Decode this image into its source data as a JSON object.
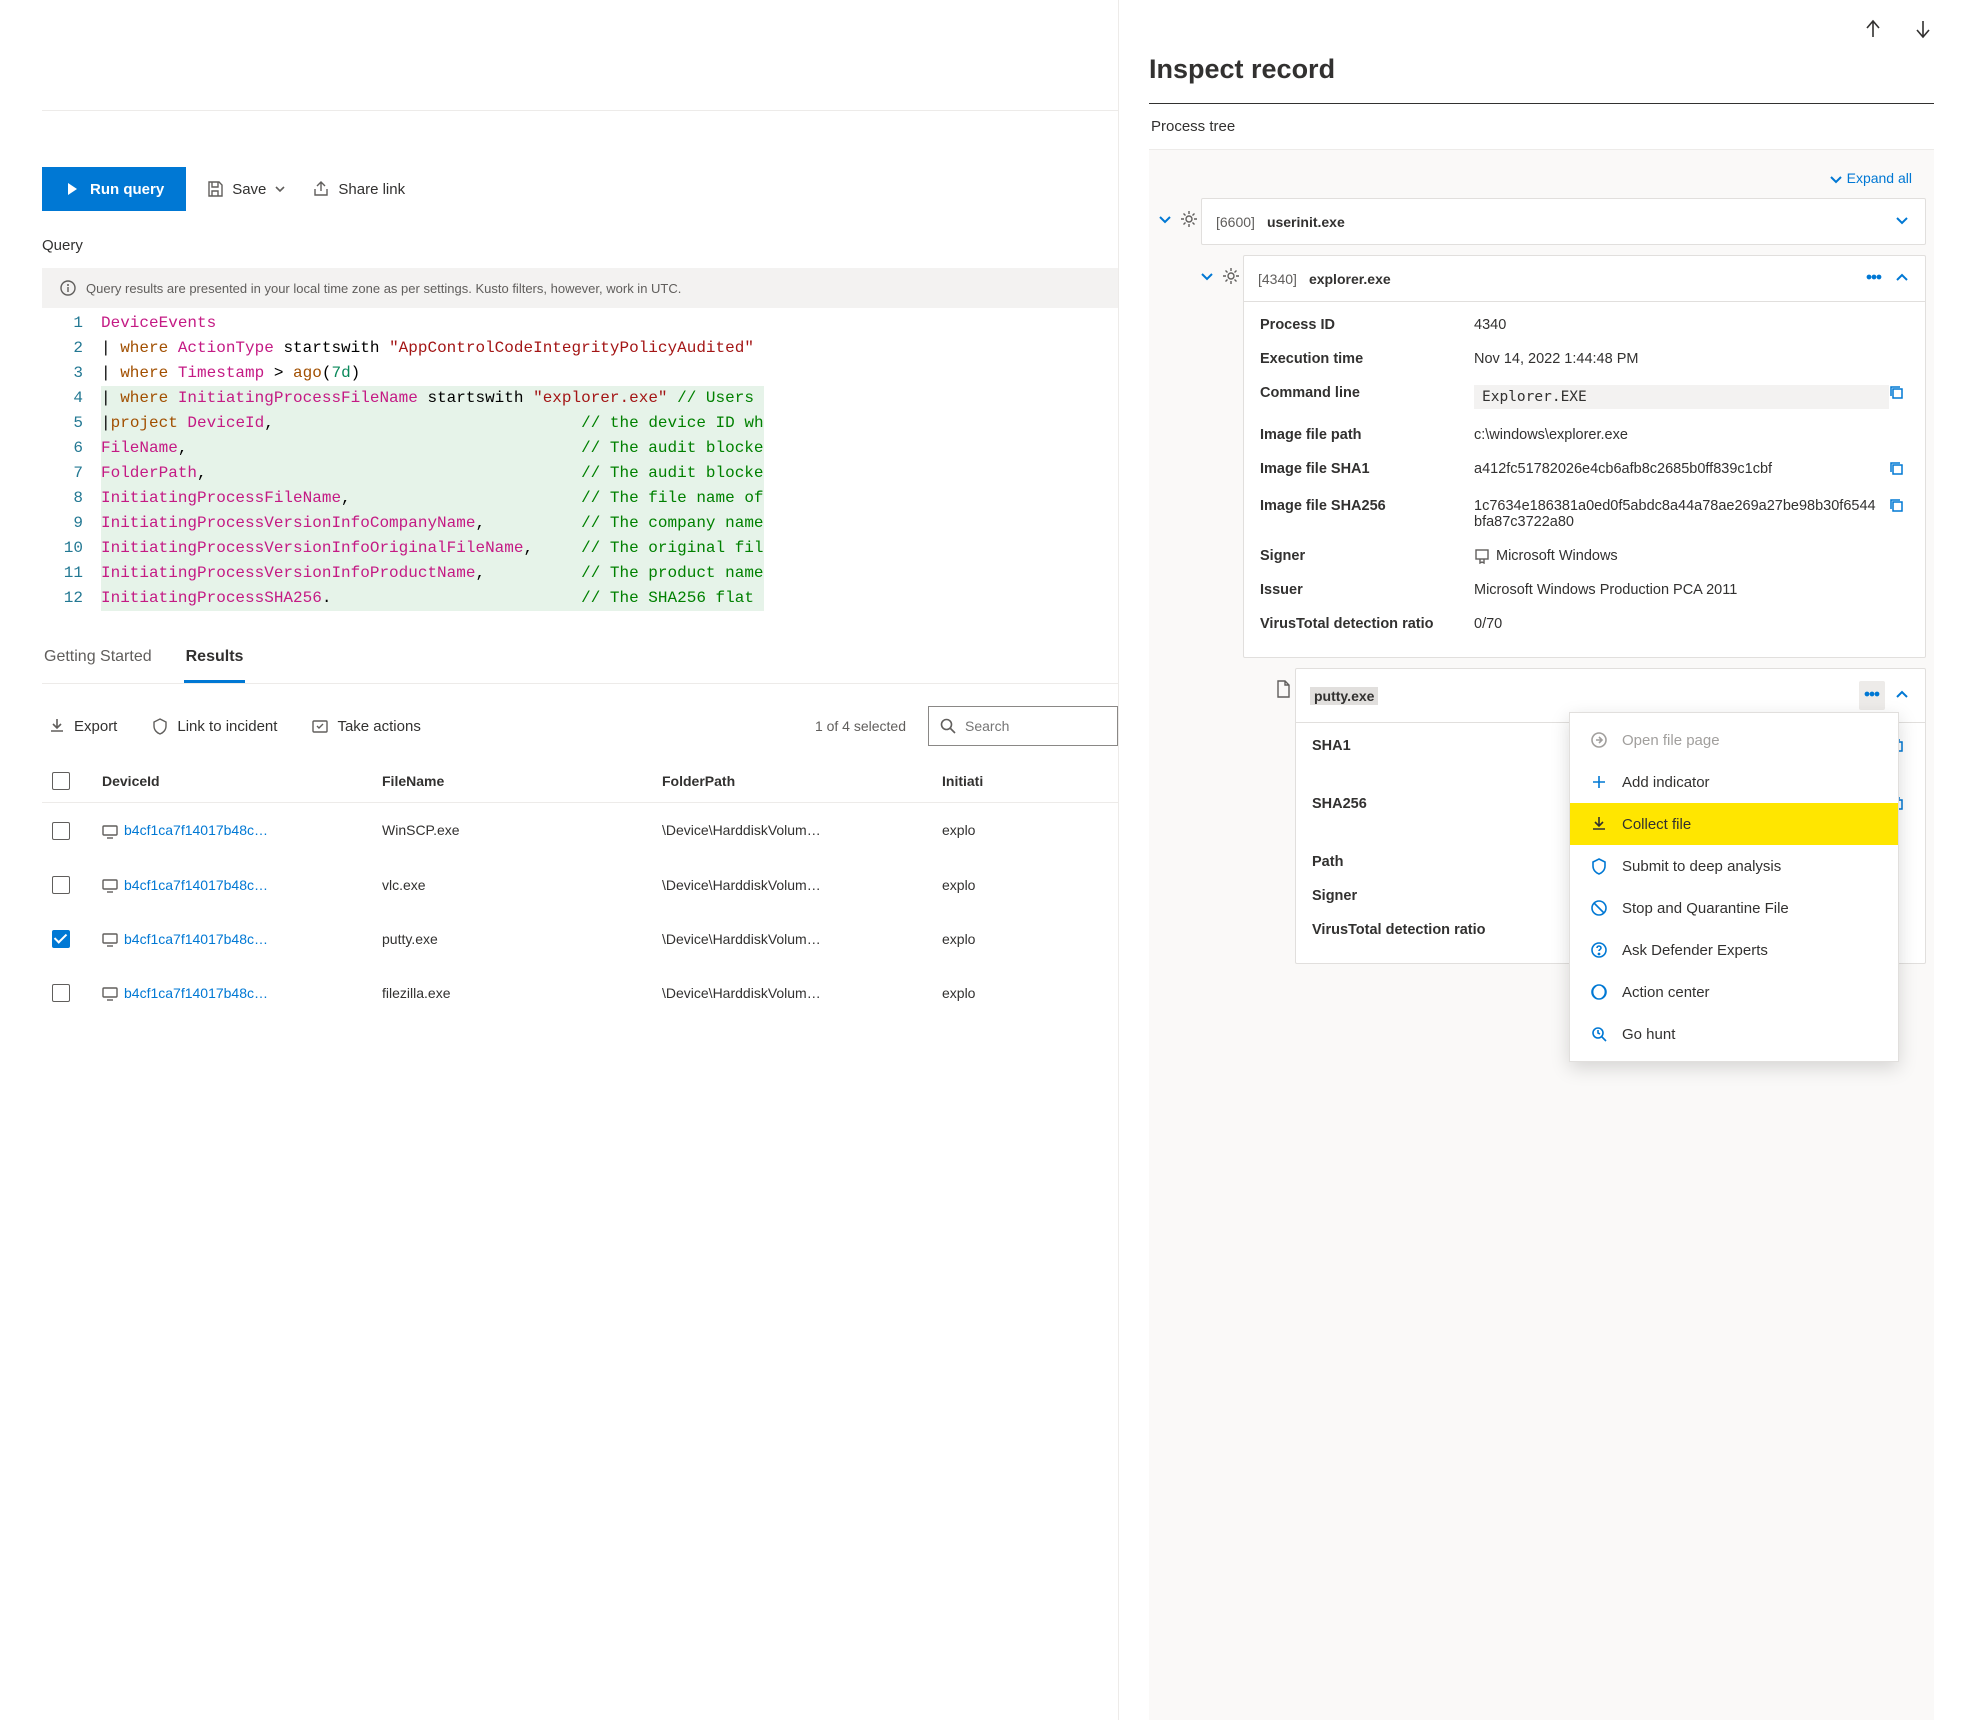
{
  "toolbar": {
    "run_query": "Run query",
    "save": "Save",
    "share": "Share link"
  },
  "query_label": "Query",
  "info_strip": "Query results are presented in your local time zone as per settings. Kusto filters, however, work in UTC.",
  "code_lines": [
    {
      "n": "1",
      "tokens": [
        {
          "t": "DeviceEvents",
          "c": "t-mag"
        }
      ]
    },
    {
      "n": "2",
      "tokens": [
        {
          "t": "| ",
          "c": "t-plain"
        },
        {
          "t": "where",
          "c": "t-key"
        },
        {
          "t": " ActionType ",
          "c": "t-mag"
        },
        {
          "t": "startswith ",
          "c": "t-plain"
        },
        {
          "t": "\"AppControlCodeIntegrityPolicyAudited\"",
          "c": "t-str"
        }
      ]
    },
    {
      "n": "3",
      "tokens": [
        {
          "t": "| ",
          "c": "t-plain"
        },
        {
          "t": "where",
          "c": "t-key"
        },
        {
          "t": " Timestamp ",
          "c": "t-mag"
        },
        {
          "t": "> ",
          "c": "t-plain"
        },
        {
          "t": "ago",
          "c": "t-key"
        },
        {
          "t": "(",
          "c": "t-plain"
        },
        {
          "t": "7d",
          "c": "t-num"
        },
        {
          "t": ")",
          "c": "t-plain"
        }
      ]
    },
    {
      "n": "4",
      "hl": true,
      "tokens": [
        {
          "t": "| ",
          "c": "t-plain"
        },
        {
          "t": "where",
          "c": "t-key"
        },
        {
          "t": " InitiatingProcessFileName ",
          "c": "t-mag"
        },
        {
          "t": "startswith ",
          "c": "t-plain"
        },
        {
          "t": "\"explorer.exe\"",
          "c": "t-str"
        },
        {
          "t": " // Users",
          "c": "t-com"
        }
      ]
    },
    {
      "n": "5",
      "hl": true,
      "tokens": [
        {
          "t": "|",
          "c": "t-plain"
        },
        {
          "t": "project",
          "c": "t-key"
        },
        {
          "t": " DeviceId",
          "c": "t-mag"
        },
        {
          "t": ",                                ",
          "c": "t-plain"
        },
        {
          "t": "// the device ID wh",
          "c": "t-com"
        }
      ]
    },
    {
      "n": "6",
      "hl": true,
      "tokens": [
        {
          "t": "FileName",
          "c": "t-mag"
        },
        {
          "t": ",                                         ",
          "c": "t-plain"
        },
        {
          "t": "// The audit blocke",
          "c": "t-com"
        }
      ]
    },
    {
      "n": "7",
      "hl": true,
      "tokens": [
        {
          "t": "FolderPath",
          "c": "t-mag"
        },
        {
          "t": ",                                       ",
          "c": "t-plain"
        },
        {
          "t": "// The audit blocke",
          "c": "t-com"
        }
      ]
    },
    {
      "n": "8",
      "hl": true,
      "tokens": [
        {
          "t": "InitiatingProcessFileName",
          "c": "t-mag"
        },
        {
          "t": ",                        ",
          "c": "t-plain"
        },
        {
          "t": "// The file name of",
          "c": "t-com"
        }
      ]
    },
    {
      "n": "9",
      "hl": true,
      "tokens": [
        {
          "t": "InitiatingProcessVersionInfoCompanyName",
          "c": "t-mag"
        },
        {
          "t": ",          ",
          "c": "t-plain"
        },
        {
          "t": "// The company name",
          "c": "t-com"
        }
      ]
    },
    {
      "n": "10",
      "hl": true,
      "tokens": [
        {
          "t": "InitiatingProcessVersionInfoOriginalFileName",
          "c": "t-mag"
        },
        {
          "t": ",     ",
          "c": "t-plain"
        },
        {
          "t": "// The original fil",
          "c": "t-com"
        }
      ]
    },
    {
      "n": "11",
      "hl": true,
      "tokens": [
        {
          "t": "InitiatingProcessVersionInfoProductName",
          "c": "t-mag"
        },
        {
          "t": ",          ",
          "c": "t-plain"
        },
        {
          "t": "// The product name",
          "c": "t-com"
        }
      ]
    },
    {
      "n": "12",
      "hl": true,
      "tokens": [
        {
          "t": "InitiatingProcessSHA256",
          "c": "t-mag"
        },
        {
          "t": ".                          ",
          "c": "t-plain"
        },
        {
          "t": "// The SHA256 flat ",
          "c": "t-com"
        }
      ]
    }
  ],
  "tabs": {
    "started": "Getting Started",
    "results": "Results"
  },
  "results_bar": {
    "export": "Export",
    "link_incident": "Link to incident",
    "take_actions": "Take actions",
    "count": "1 of 4 selected",
    "search_ph": "Search"
  },
  "table": {
    "headers": {
      "device": "DeviceId",
      "file": "FileName",
      "folder": "FolderPath",
      "init": "Initiati"
    },
    "rows": [
      {
        "checked": false,
        "device": "b4cf1ca7f14017b48c…",
        "file": "WinSCP.exe",
        "folder": "\\Device\\HarddiskVolum…",
        "init": "explo"
      },
      {
        "checked": false,
        "device": "b4cf1ca7f14017b48c…",
        "file": "vlc.exe",
        "folder": "\\Device\\HarddiskVolum…",
        "init": "explo"
      },
      {
        "checked": true,
        "device": "b4cf1ca7f14017b48c…",
        "file": "putty.exe",
        "folder": "\\Device\\HarddiskVolum…",
        "init": "explo"
      },
      {
        "checked": false,
        "device": "b4cf1ca7f14017b48c…",
        "file": "filezilla.exe",
        "folder": "\\Device\\HarddiskVolum…",
        "init": "explo"
      }
    ]
  },
  "inspect": {
    "title": "Inspect record",
    "section": "Process tree",
    "expand_all": "Expand all",
    "node1": {
      "pid": "[6600]",
      "name": "userinit.exe"
    },
    "node2": {
      "pid": "[4340]",
      "name": "explorer.exe",
      "details": {
        "process_id_l": "Process ID",
        "process_id": "4340",
        "exec_time_l": "Execution time",
        "exec_time": "Nov 14, 2022 1:44:48 PM",
        "cmd_l": "Command line",
        "cmd": "Explorer.EXE",
        "path_l": "Image file path",
        "path": "c:\\windows\\explorer.exe",
        "sha1_l": "Image file SHA1",
        "sha1": "a412fc51782026e4cb6afb8c2685b0ff839c1cbf",
        "sha256_l": "Image file SHA256",
        "sha256": "1c7634e186381a0ed0f5abdc8a44a78ae269a27be98b30f6544bfa87c3722a80",
        "signer_l": "Signer",
        "signer": "Microsoft Windows",
        "issuer_l": "Issuer",
        "issuer": "Microsoft Windows Production PCA 2011",
        "vt_l": "VirusTotal detection ratio",
        "vt": "0/70"
      }
    },
    "node3": {
      "name": "putty.exe",
      "details": {
        "sha1_l": "SHA1",
        "sha256_l": "SHA256",
        "path_l": "Path",
        "signer_l": "Signer",
        "vt_l": "VirusTotal detection ratio"
      }
    }
  },
  "menu": {
    "open_file": "Open file page",
    "add_indicator": "Add indicator",
    "collect_file": "Collect file",
    "deep_analysis": "Submit to deep analysis",
    "stop_quarantine": "Stop and Quarantine File",
    "ask_experts": "Ask Defender Experts",
    "action_center": "Action center",
    "go_hunt": "Go hunt"
  }
}
